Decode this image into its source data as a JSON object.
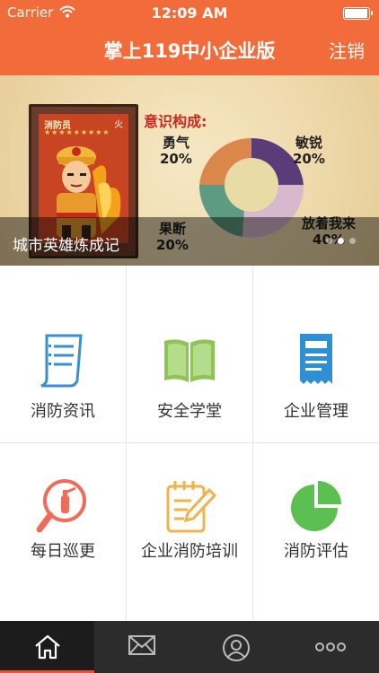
{
  "status_bar": {
    "carrier": "Carrier",
    "time": "12:09 AM",
    "battery_level": 1.0
  },
  "nav": {
    "title": "掌上119中小企业版",
    "logout_label": "注销"
  },
  "banner": {
    "card_label": "消防员",
    "card_corner": "火",
    "heading": "意识构成:",
    "segments": [
      {
        "label": "勇气",
        "percent": "20%",
        "color": "#d9874b"
      },
      {
        "label": "敏锐",
        "percent": "20%",
        "color": "#5b3b78"
      },
      {
        "label": "果断",
        "percent": "20%",
        "color": "#5d9b83"
      },
      {
        "label": "放着我来",
        "percent": "40%",
        "color": "#d8b8cc"
      }
    ],
    "caption": "城市英雄炼成记",
    "page_count": 3,
    "active_page": 2
  },
  "grid": {
    "items": [
      {
        "label": "消防资讯",
        "icon": "news-document-icon"
      },
      {
        "label": "安全学堂",
        "icon": "open-book-icon"
      },
      {
        "label": "企业管理",
        "icon": "receipt-document-icon"
      },
      {
        "label": "每日巡更",
        "icon": "extinguisher-magnifier-icon"
      },
      {
        "label": "企业消防培训",
        "icon": "notepad-pencil-icon"
      },
      {
        "label": "消防评估",
        "icon": "pie-chart-icon"
      }
    ]
  },
  "tabs": [
    {
      "name": "home",
      "icon": "home-icon",
      "active": true
    },
    {
      "name": "messages",
      "icon": "envelope-icon",
      "active": false
    },
    {
      "name": "profile",
      "icon": "person-icon",
      "active": false
    },
    {
      "name": "more",
      "icon": "more-dots-icon",
      "active": false
    }
  ]
}
